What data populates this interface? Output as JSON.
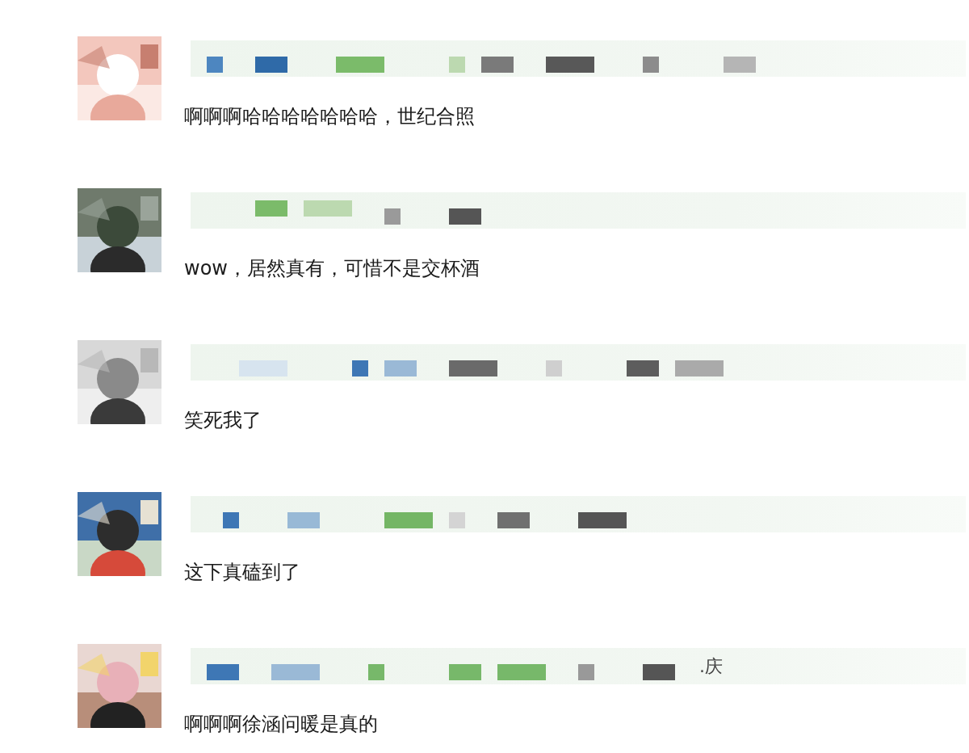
{
  "comments": [
    {
      "text": "啊啊啊哈哈哈哈哈哈哈，世纪合照"
    },
    {
      "text": "wow，居然真有，可惜不是交杯酒"
    },
    {
      "text": "笑死我了"
    },
    {
      "text": "这下真磕到了"
    },
    {
      "name_fragment": ".庆",
      "text": "啊啊啊徐涵问暖是真的"
    }
  ]
}
